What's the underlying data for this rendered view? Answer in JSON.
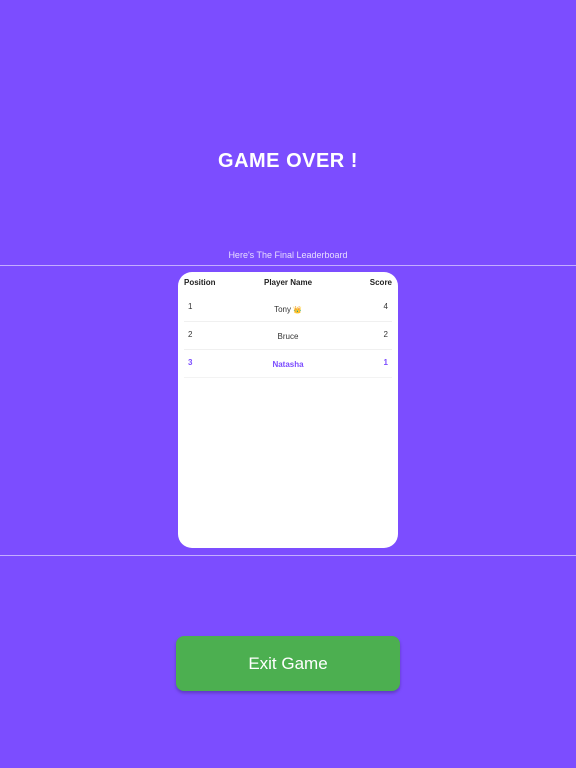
{
  "screen": {
    "title": "GAME OVER !",
    "subtitle": "Here's The Final Leaderboard"
  },
  "leaderboard": {
    "headers": {
      "position": "Position",
      "player_name": "Player Name",
      "score": "Score"
    },
    "rows": [
      {
        "position": "1",
        "name": "Tony",
        "badge": "👑",
        "score": "4"
      },
      {
        "position": "2",
        "name": "Bruce",
        "badge": "",
        "score": "2"
      },
      {
        "position": "3",
        "name": "Natasha",
        "badge": "",
        "score": "1",
        "highlighted": true
      }
    ]
  },
  "actions": {
    "exit_label": "Exit Game"
  },
  "colors": {
    "background": "#7c4dff",
    "highlight": "#7c4dff",
    "exit_button": "#4caf50",
    "card": "#ffffff"
  },
  "icons": {
    "winner_badge": "crown-icon"
  }
}
